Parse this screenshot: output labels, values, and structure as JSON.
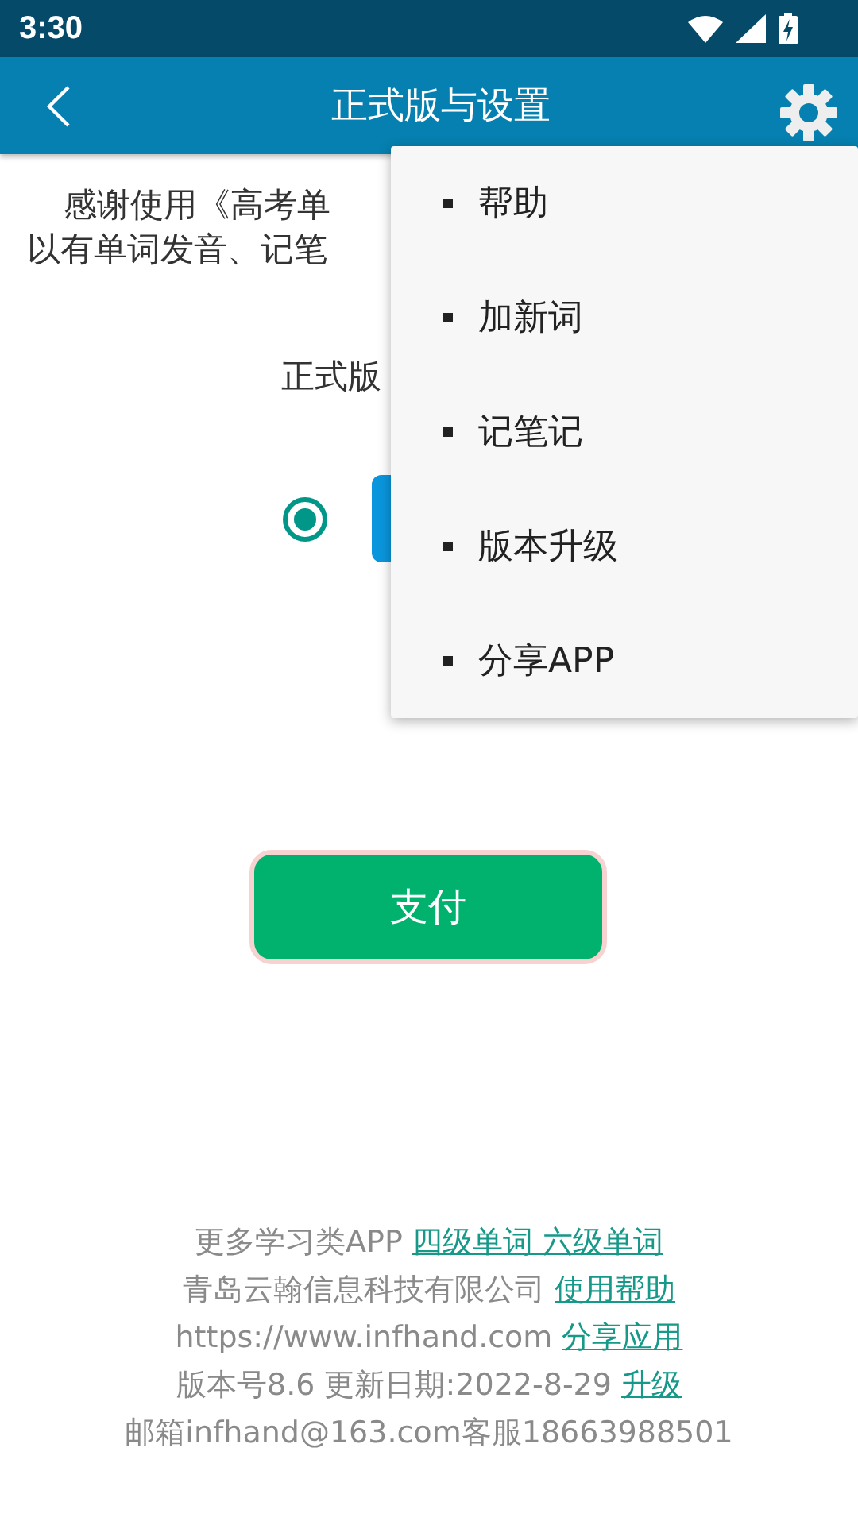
{
  "status_bar": {
    "time": "3:30"
  },
  "app_bar": {
    "title": "正式版与设置"
  },
  "intro_lines": [
    "感谢使用《高考单",
    "以有单词发音、记笔"
  ],
  "version_label": "正式版",
  "plan_option": {
    "selected": true
  },
  "pay_button": "支付",
  "footer": [
    {
      "parts": [
        {
          "kind": "text",
          "text": "更多学习类APP "
        },
        {
          "kind": "link",
          "text": "四级单词 六级单词"
        }
      ]
    },
    {
      "parts": [
        {
          "kind": "text",
          "text": "青岛云翰信息科技有限公司 "
        },
        {
          "kind": "link",
          "text": "使用帮助"
        }
      ]
    },
    {
      "parts": [
        {
          "kind": "text",
          "text": "https://www.infhand.com "
        },
        {
          "kind": "link",
          "text": " 分享应用"
        }
      ]
    },
    {
      "parts": [
        {
          "kind": "text",
          "text": "版本号8.6 更新日期:2022-8-29 "
        },
        {
          "kind": "link",
          "text": " 升级"
        }
      ]
    },
    {
      "parts": [
        {
          "kind": "text",
          "text": "邮箱infhand@163.com客服18663988501"
        }
      ]
    }
  ],
  "menu": {
    "items": [
      {
        "label": "帮助"
      },
      {
        "label": "加新词"
      },
      {
        "label": "记笔记"
      },
      {
        "label": "版本升级"
      },
      {
        "label": "分享APP"
      }
    ]
  }
}
